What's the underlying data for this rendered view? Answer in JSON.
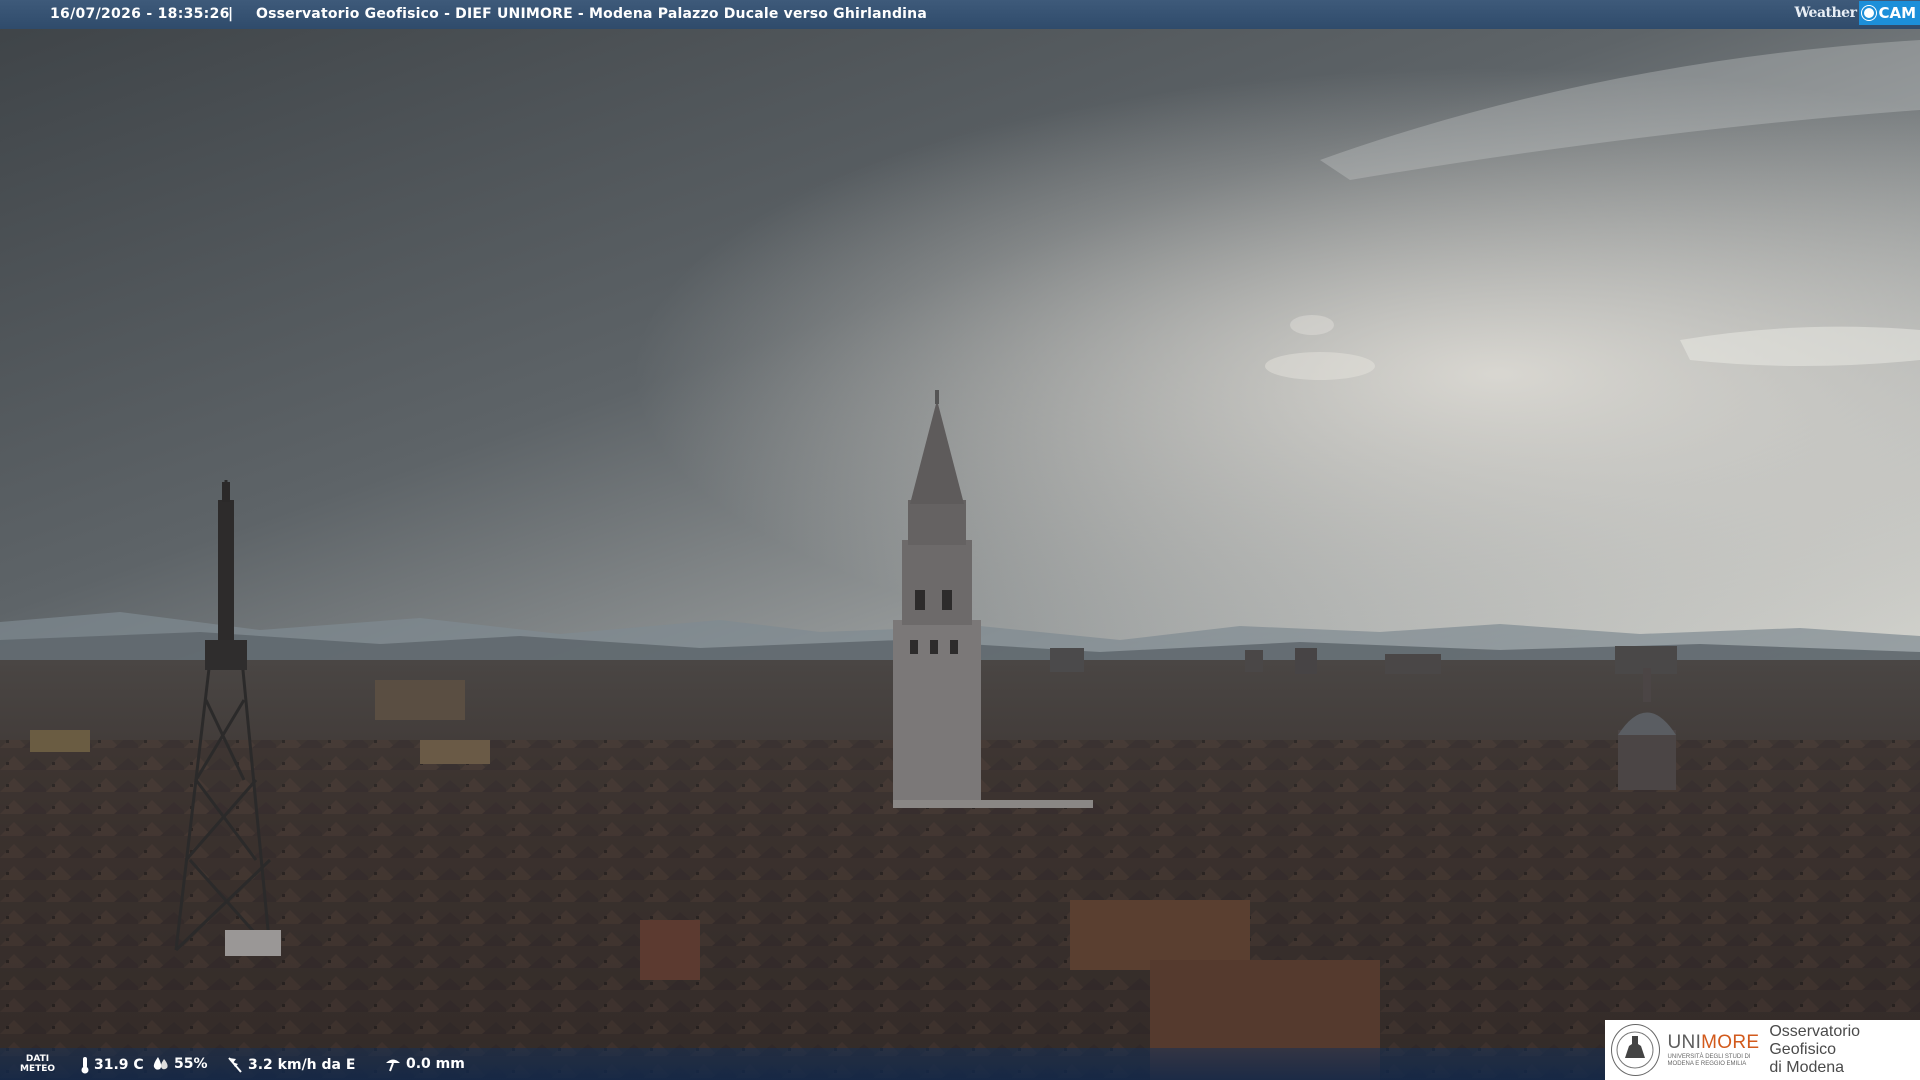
{
  "overlay": {
    "timestamp": "16/07/2026 - 18:35:26",
    "separator": "|",
    "title": "Osservatorio Geofisico - DIEF UNIMORE - Modena Palazzo Ducale verso Ghirlandina"
  },
  "brand": {
    "weather": "Weather",
    "cam": "CAM"
  },
  "meteo": {
    "label_line1": "DATI",
    "label_line2": "METEO",
    "temperature": "31.9 C",
    "humidity": "55%",
    "wind": "3.2 km/h da E",
    "rain": "0.0 mm"
  },
  "logo": {
    "uni": "UNI",
    "more": "MORE",
    "sub_line1": "UNIVERSITÀ DEGLI STUDI DI",
    "sub_line2": "MODENA E REGGIO EMILIA",
    "observatory_line1": "Osservatorio Geofisico",
    "observatory_line2": "di Modena"
  },
  "colors": {
    "top_bar": "#3e5a7a",
    "cam_badge": "#1c8fd9",
    "unimore_accent": "#d25a1c"
  },
  "icons": [
    "thermometer-icon",
    "humidity-drop-icon",
    "wind-icon",
    "rain-gauge-icon",
    "wind-vane-icon"
  ]
}
